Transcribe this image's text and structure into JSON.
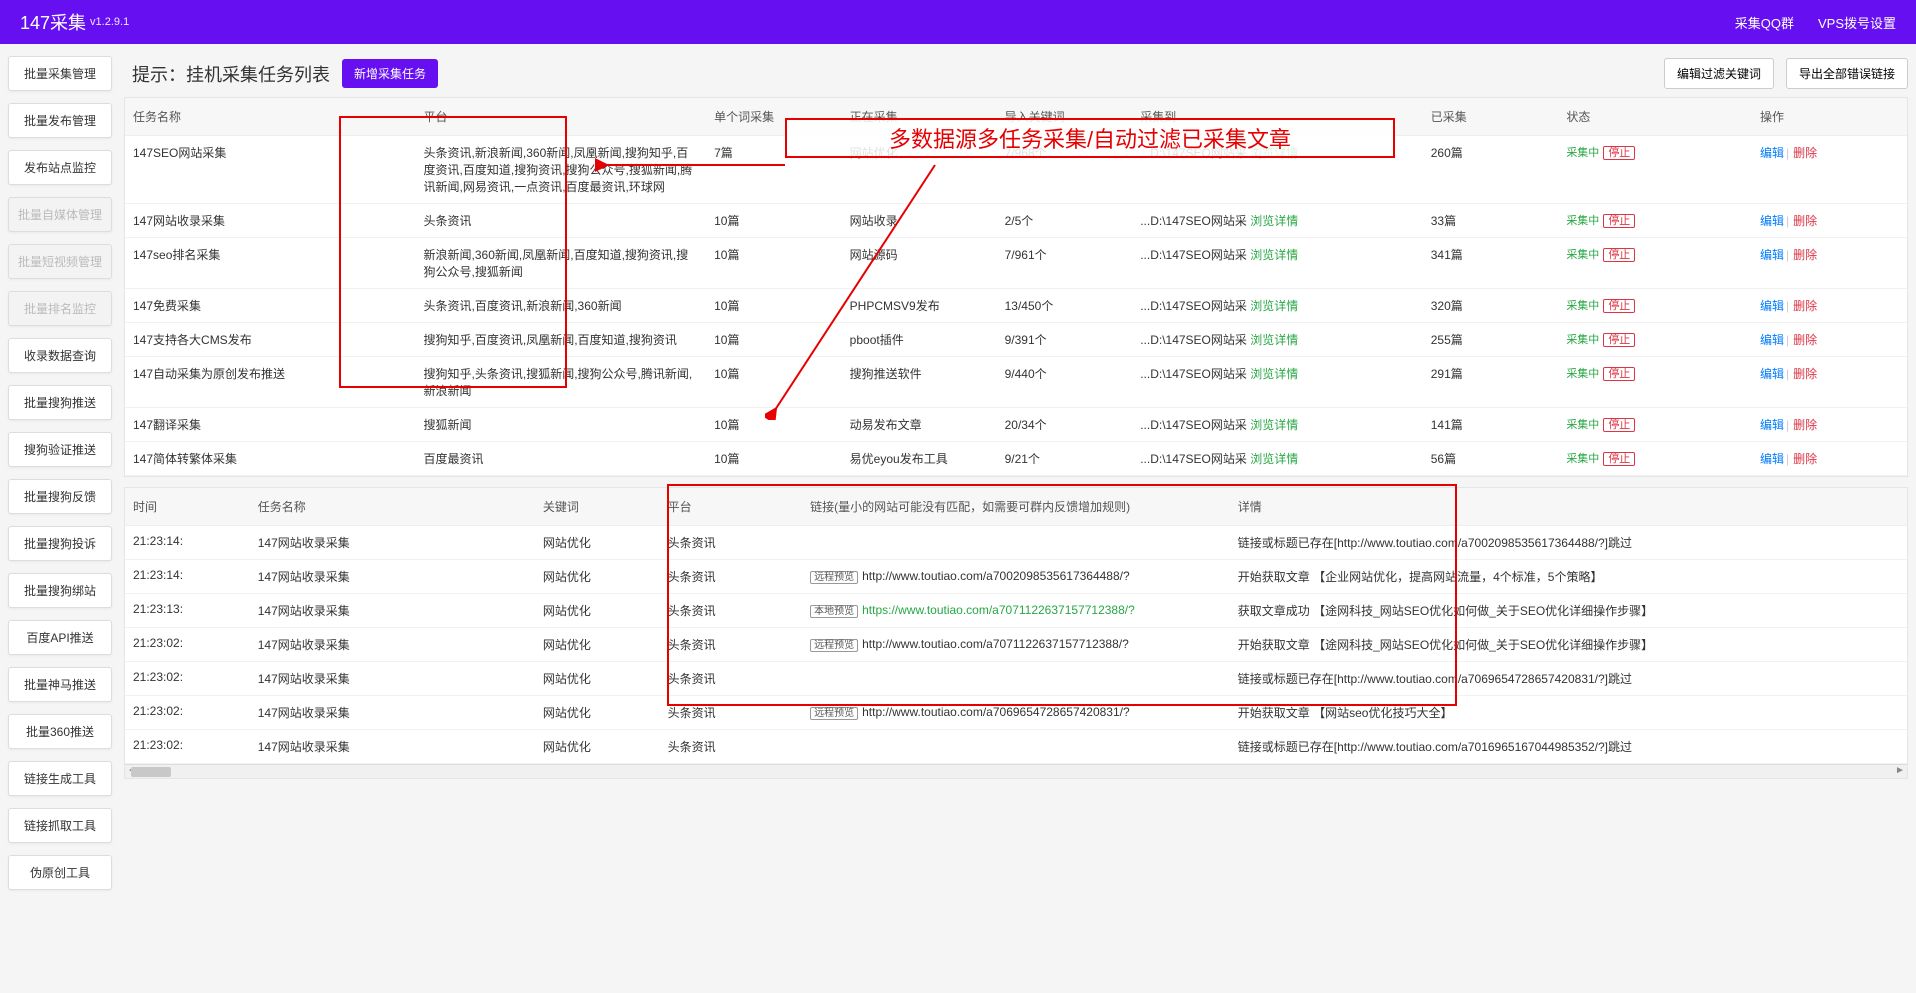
{
  "header": {
    "brand": "147采集",
    "version": "v1.2.9.1",
    "links": {
      "qq": "采集QQ群",
      "vps": "VPS拨号设置"
    }
  },
  "sidebar": {
    "items": [
      {
        "label": "批量采集管理",
        "disabled": false
      },
      {
        "label": "批量发布管理",
        "disabled": false
      },
      {
        "label": "发布站点监控",
        "disabled": false
      },
      {
        "label": "批量自媒体管理",
        "disabled": true
      },
      {
        "label": "批量短视频管理",
        "disabled": true
      },
      {
        "label": "批量排名监控",
        "disabled": true
      },
      {
        "label": "收录数据查询",
        "disabled": false
      },
      {
        "label": "批量搜狗推送",
        "disabled": false
      },
      {
        "label": "搜狗验证推送",
        "disabled": false
      },
      {
        "label": "批量搜狗反馈",
        "disabled": false
      },
      {
        "label": "批量搜狗投诉",
        "disabled": false
      },
      {
        "label": "批量搜狗绑站",
        "disabled": false
      },
      {
        "label": "百度API推送",
        "disabled": false
      },
      {
        "label": "批量神马推送",
        "disabled": false
      },
      {
        "label": "批量360推送",
        "disabled": false
      },
      {
        "label": "链接生成工具",
        "disabled": false
      },
      {
        "label": "链接抓取工具",
        "disabled": false
      },
      {
        "label": "伪原创工具",
        "disabled": false
      }
    ]
  },
  "titlebar": {
    "hint": "提示：挂机采集任务列表",
    "add": "新增采集任务",
    "filter": "编辑过滤关键词",
    "export": "导出全部错误链接"
  },
  "annotation": {
    "callout": "多数据源多任务采集/自动过滤已采集文章"
  },
  "taskTable": {
    "headers": {
      "name": "任务名称",
      "platform": "平台",
      "single": "单个词采集",
      "running": "正在采集",
      "keywords": "导入关键词",
      "collectTo": "采集到",
      "collected": "已采集",
      "status": "状态",
      "op": "操作"
    },
    "statusText": "采集中",
    "stopText": "停止",
    "detailText": "浏览详情",
    "editText": "编辑",
    "delText": "删除",
    "pathText": "...D:\\147SEO网站采",
    "rows": [
      {
        "name": "147SEO网站采集",
        "platform": "头条资讯,新浪新闻,360新闻,凤凰新闻,搜狗知乎,百度资讯,百度知道,搜狗资讯,搜狗公众号,搜狐新闻,腾讯新闻,网易资讯,一点资讯,百度最资讯,环球网",
        "single": "7篇",
        "running": "网站优化",
        "keywords": "7/968个",
        "collected": "260篇"
      },
      {
        "name": "147网站收录采集",
        "platform": "头条资讯",
        "single": "10篇",
        "running": "网站收录",
        "keywords": "2/5个",
        "collected": "33篇"
      },
      {
        "name": "147seo排名采集",
        "platform": "新浪新闻,360新闻,凤凰新闻,百度知道,搜狗资讯,搜狗公众号,搜狐新闻",
        "single": "10篇",
        "running": "网站源码",
        "keywords": "7/961个",
        "collected": "341篇"
      },
      {
        "name": "147免费采集",
        "platform": "头条资讯,百度资讯,新浪新闻,360新闻",
        "single": "10篇",
        "running": "PHPCMSV9发布",
        "keywords": "13/450个",
        "collected": "320篇"
      },
      {
        "name": "147支持各大CMS发布",
        "platform": "搜狗知乎,百度资讯,凤凰新闻,百度知道,搜狗资讯",
        "single": "10篇",
        "running": "pboot插件",
        "keywords": "9/391个",
        "collected": "255篇"
      },
      {
        "name": "147自动采集为原创发布推送",
        "platform": "搜狗知乎,头条资讯,搜狐新闻,搜狗公众号,腾讯新闻,新浪新闻",
        "single": "10篇",
        "running": "搜狗推送软件",
        "keywords": "9/440个",
        "collected": "291篇"
      },
      {
        "name": "147翻译采集",
        "platform": "搜狐新闻",
        "single": "10篇",
        "running": "动易发布文章",
        "keywords": "20/34个",
        "collected": "141篇"
      },
      {
        "name": "147简体转繁体采集",
        "platform": "百度最资讯",
        "single": "10篇",
        "running": "易优eyou发布工具",
        "keywords": "9/21个",
        "collected": "56篇"
      }
    ]
  },
  "logTable": {
    "headers": {
      "time": "时间",
      "task": "任务名称",
      "keyword": "关键词",
      "platform": "平台",
      "link": "链接(量小的网站可能没有匹配，如需要可群内反馈增加规则)",
      "detail": "详情"
    },
    "badgeRemote": "远程预览",
    "badgeLocal": "本地预览",
    "rows": [
      {
        "time": "21:23:14:",
        "task": "147网站收录采集",
        "keyword": "网站优化",
        "platform": "头条资讯",
        "url": "",
        "badge": "",
        "detail": "链接或标题已存在[http://www.toutiao.com/a7002098535617364488/?]跳过"
      },
      {
        "time": "21:23:14:",
        "task": "147网站收录采集",
        "keyword": "网站优化",
        "platform": "头条资讯",
        "url": "http://www.toutiao.com/a7002098535617364488/?",
        "badge": "remote",
        "detail": "开始获取文章 【企业网站优化，提高网站流量，4个标准，5个策略】"
      },
      {
        "time": "21:23:13:",
        "task": "147网站收录采集",
        "keyword": "网站优化",
        "platform": "头条资讯",
        "url": "https://www.toutiao.com/a7071122637157712388/?",
        "badge": "local",
        "green": true,
        "detail": "获取文章成功 【途网科技_网站SEO优化如何做_关于SEO优化详细操作步骤】"
      },
      {
        "time": "21:23:02:",
        "task": "147网站收录采集",
        "keyword": "网站优化",
        "platform": "头条资讯",
        "url": "http://www.toutiao.com/a7071122637157712388/?",
        "badge": "remote",
        "detail": "开始获取文章 【途网科技_网站SEO优化如何做_关于SEO优化详细操作步骤】"
      },
      {
        "time": "21:23:02:",
        "task": "147网站收录采集",
        "keyword": "网站优化",
        "platform": "头条资讯",
        "url": "",
        "badge": "",
        "detail": "链接或标题已存在[http://www.toutiao.com/a7069654728657420831/?]跳过"
      },
      {
        "time": "21:23:02:",
        "task": "147网站收录采集",
        "keyword": "网站优化",
        "platform": "头条资讯",
        "url": "http://www.toutiao.com/a7069654728657420831/?",
        "badge": "remote",
        "detail": "开始获取文章 【网站seo优化技巧大全】"
      },
      {
        "time": "21:23:02:",
        "task": "147网站收录采集",
        "keyword": "网站优化",
        "platform": "头条资讯",
        "url": "",
        "badge": "",
        "detail": "链接或标题已存在[http://www.toutiao.com/a7016965167044985352/?]跳过"
      }
    ]
  }
}
